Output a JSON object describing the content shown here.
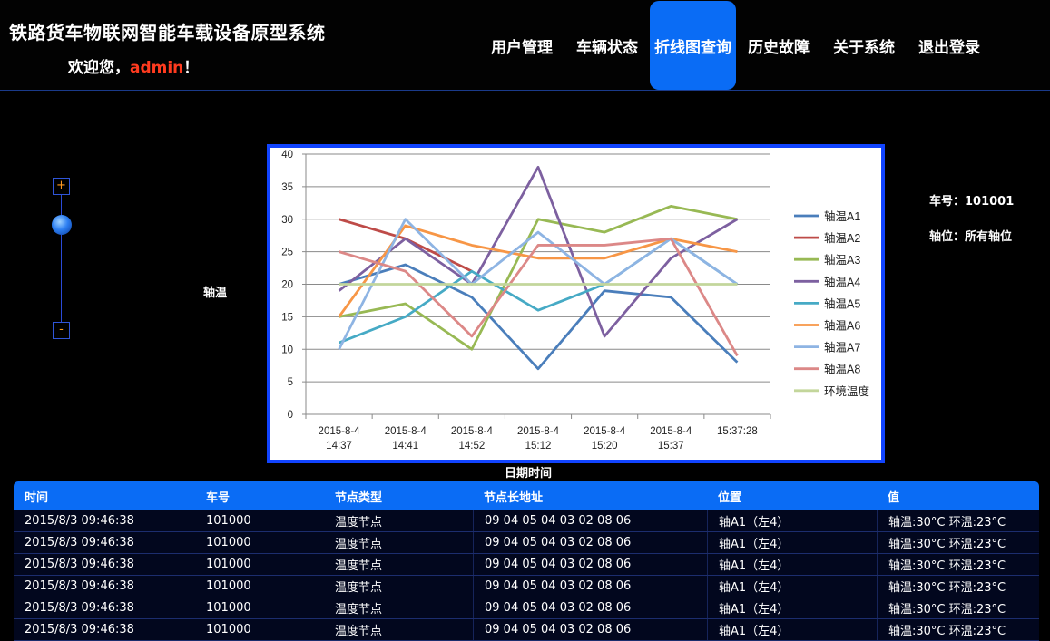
{
  "header": {
    "app_title": "铁路货车物联网智能车载设备原型系统",
    "welcome_prefix": "欢迎您，",
    "username": "admin",
    "welcome_suffix": "！",
    "nav": [
      {
        "label": "用户管理",
        "active": false
      },
      {
        "label": "车辆状态",
        "active": false
      },
      {
        "label": "折线图查询",
        "active": true
      },
      {
        "label": "历史故障",
        "active": false
      },
      {
        "label": "关于系统",
        "active": false
      },
      {
        "label": "退出登录",
        "active": false
      }
    ]
  },
  "zoom": {
    "plus": "+",
    "minus": "-"
  },
  "side_label": "轴温",
  "info": {
    "car_no": "车号：101001",
    "axle": "轴位：所有轴位"
  },
  "chart_data": {
    "type": "line",
    "title": "",
    "xlabel": "日期时间",
    "ylabel": "轴温",
    "ylim": [
      0,
      40
    ],
    "yticks": [
      0,
      5,
      10,
      15,
      20,
      25,
      30,
      35,
      40
    ],
    "grid": true,
    "legend_position": "right",
    "categories": [
      [
        "2015-8-4",
        "14:37"
      ],
      [
        "2015-8-4",
        "14:41"
      ],
      [
        "2015-8-4",
        "14:52"
      ],
      [
        "2015-8-4",
        "15:12"
      ],
      [
        "2015-8-4",
        "15:20"
      ],
      [
        "2015-8-4",
        "15:37"
      ],
      [
        "15:37:28",
        ""
      ]
    ],
    "series": [
      {
        "name": "轴温A1",
        "color": "#4a7ebb",
        "values": [
          20,
          23,
          18,
          7,
          19,
          18,
          8
        ]
      },
      {
        "name": "轴温A2",
        "color": "#be4b48",
        "values": [
          30,
          27,
          22,
          null,
          null,
          null,
          null
        ]
      },
      {
        "name": "轴温A3",
        "color": "#98b954",
        "values": [
          15,
          17,
          10,
          30,
          28,
          32,
          30
        ]
      },
      {
        "name": "轴温A4",
        "color": "#7d60a0",
        "values": [
          19,
          27,
          20,
          38,
          12,
          24,
          30
        ]
      },
      {
        "name": "轴温A5",
        "color": "#46aac5",
        "values": [
          11,
          15,
          22,
          16,
          20,
          27,
          20
        ]
      },
      {
        "name": "轴温A6",
        "color": "#f79646",
        "values": [
          15,
          29,
          26,
          24,
          24,
          27,
          25
        ]
      },
      {
        "name": "轴温A7",
        "color": "#8eb4e3",
        "values": [
          10,
          30,
          20,
          28,
          20,
          27,
          20
        ]
      },
      {
        "name": "轴温A8",
        "color": "#dc8887",
        "values": [
          25,
          22,
          12,
          26,
          26,
          27,
          9
        ]
      },
      {
        "name": "环境温度",
        "color": "#c3d69b",
        "values": [
          20,
          20,
          20,
          20,
          20,
          20,
          20
        ]
      }
    ]
  },
  "table": {
    "headers": [
      "时间",
      "车号",
      "节点类型",
      "节点长地址",
      "位置",
      "值"
    ],
    "rows": [
      [
        "2015/8/3 09:46:38",
        "101000",
        "温度节点",
        "09 04 05 04 03 02 08 06",
        "轴A1（左4）",
        "轴温:30°C   环温:23°C"
      ],
      [
        "2015/8/3 09:46:38",
        "101000",
        "温度节点",
        "09 04 05 04 03 02 08 06",
        "轴A1（左4）",
        "轴温:30°C   环温:23°C"
      ],
      [
        "2015/8/3 09:46:38",
        "101000",
        "温度节点",
        "09 04 05 04 03 02 08 06",
        "轴A1（左4）",
        "轴温:30°C   环温:23°C"
      ],
      [
        "2015/8/3 09:46:38",
        "101000",
        "温度节点",
        "09 04 05 04 03 02 08 06",
        "轴A1（左4）",
        "轴温:30°C   环温:23°C"
      ],
      [
        "2015/8/3 09:46:38",
        "101000",
        "温度节点",
        "09 04 05 04 03 02 08 06",
        "轴A1（左4）",
        "轴温:30°C   环温:23°C"
      ],
      [
        "2015/8/3 09:46:38",
        "101000",
        "温度节点",
        "09 04 05 04 03 02 08 06",
        "轴A1（左4）",
        "轴温:30°C   环温:23°C"
      ]
    ]
  }
}
